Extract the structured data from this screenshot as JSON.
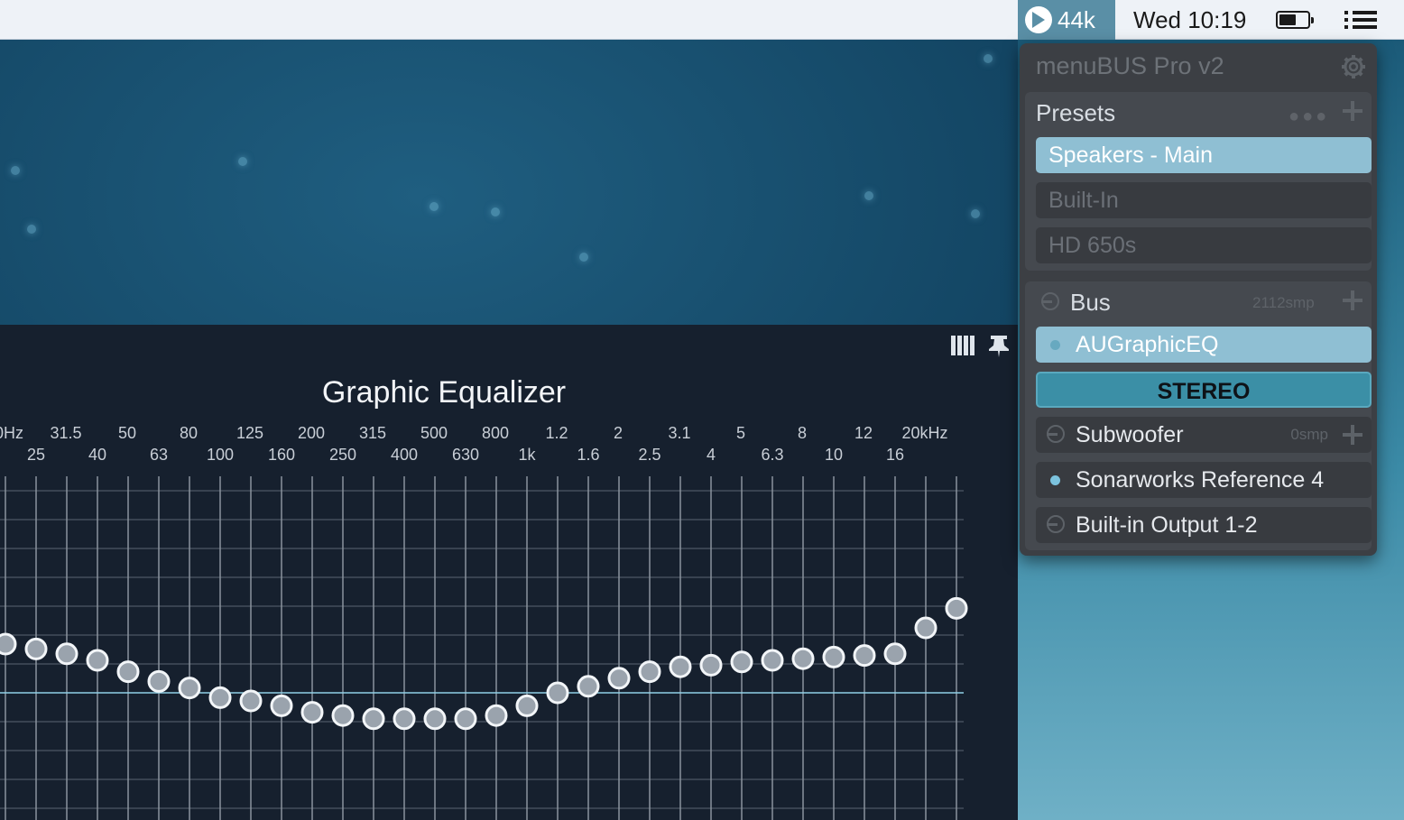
{
  "menubar": {
    "app_badge": "44k",
    "clock": "Wed 10:19"
  },
  "eq": {
    "title": "Graphic Equalizer",
    "top_labels": [
      "0Hz",
      "31.5",
      "50",
      "80",
      "125",
      "200",
      "315",
      "500",
      "800",
      "1.2",
      "2",
      "3.1",
      "5",
      "8",
      "12",
      "20kHz"
    ],
    "bottom_labels": [
      "25",
      "40",
      "63",
      "100",
      "160",
      "250",
      "400",
      "630",
      "1k",
      "1.6",
      "2.5",
      "4",
      "6.3",
      "10",
      "16"
    ],
    "band_gains_db": [
      3.0,
      2.7,
      2.4,
      2.0,
      1.3,
      0.7,
      0.3,
      -0.3,
      -0.5,
      -0.8,
      -1.2,
      -1.4,
      -1.6,
      -1.6,
      -1.6,
      -1.6,
      -1.4,
      -0.8,
      0.0,
      0.4,
      0.9,
      1.3,
      1.6,
      1.7,
      1.9,
      2.0,
      2.1,
      2.2,
      2.3,
      2.4,
      4.0,
      5.2
    ],
    "accent": "#8fd0e6"
  },
  "menubus": {
    "title": "menuBUS Pro v2",
    "presets_header": "Presets",
    "presets": [
      {
        "label": "Speakers - Main",
        "selected": true
      },
      {
        "label": "Built-In",
        "selected": false
      },
      {
        "label": "HD 650s",
        "selected": false
      }
    ],
    "bus_header": "Bus",
    "bus_latency": "2112smp",
    "plugin": "AUGraphicEQ",
    "channel_mode": "STEREO",
    "subwoofer": "Subwoofer",
    "subwoofer_latency": "0smp",
    "sonarworks": "Sonarworks Reference 4",
    "output": "Built-in Output 1-2",
    "colors": {
      "selected": "#8fbfd3",
      "stereo": "#3b8fa6"
    }
  }
}
